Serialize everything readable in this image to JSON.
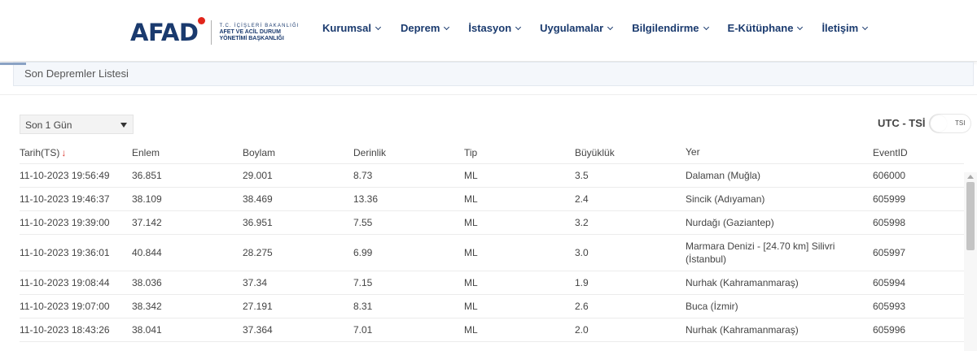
{
  "header": {
    "logo": {
      "mark": "AFAD",
      "line1": "T.C. İÇİŞLERİ BAKANLIĞI",
      "line2": "AFET VE ACİL DURUM",
      "line3": "YÖNETİMİ BAŞKANLIĞI"
    },
    "nav": [
      {
        "label": "Kurumsal"
      },
      {
        "label": "Deprem"
      },
      {
        "label": "İstasyon"
      },
      {
        "label": "Uygulamalar"
      },
      {
        "label": "Bilgilendirme"
      },
      {
        "label": "E-Kütüphane"
      },
      {
        "label": "İletişim"
      }
    ]
  },
  "page": {
    "title": "Son Depremler Listesi"
  },
  "filter": {
    "selected": "Son 1 Gün"
  },
  "timezone": {
    "label": "UTC - TSİ",
    "toggle_label": "TSI"
  },
  "table": {
    "columns": [
      "Tarih(TS)",
      "Enlem",
      "Boylam",
      "Derinlik",
      "Tip",
      "Büyüklük",
      "Yer",
      "EventID"
    ],
    "rows": [
      [
        "11-10-2023 19:56:49",
        "36.851",
        "29.001",
        "8.73",
        "ML",
        "3.5",
        "Dalaman (Muğla)",
        "606000"
      ],
      [
        "11-10-2023 19:46:37",
        "38.109",
        "38.469",
        "13.36",
        "ML",
        "2.4",
        "Sincik (Adıyaman)",
        "605999"
      ],
      [
        "11-10-2023 19:39:00",
        "37.142",
        "36.951",
        "7.55",
        "ML",
        "3.2",
        "Nurdağı (Gaziantep)",
        "605998"
      ],
      [
        "11-10-2023 19:36:01",
        "40.844",
        "28.275",
        "6.99",
        "ML",
        "3.0",
        "Marmara Denizi - [24.70 km] Silivri (İstanbul)",
        "605997"
      ],
      [
        "11-10-2023 19:08:44",
        "38.036",
        "37.34",
        "7.15",
        "ML",
        "1.9",
        "Nurhak (Kahramanmaraş)",
        "605994"
      ],
      [
        "11-10-2023 19:07:00",
        "38.342",
        "27.191",
        "8.31",
        "ML",
        "2.6",
        "Buca (İzmir)",
        "605993"
      ],
      [
        "11-10-2023 18:43:26",
        "38.041",
        "37.364",
        "7.01",
        "ML",
        "2.0",
        "Nurhak (Kahramanmaraş)",
        "605996"
      ]
    ]
  },
  "colors": {
    "brand": "#1a3a6e",
    "accent": "#e1251b"
  }
}
